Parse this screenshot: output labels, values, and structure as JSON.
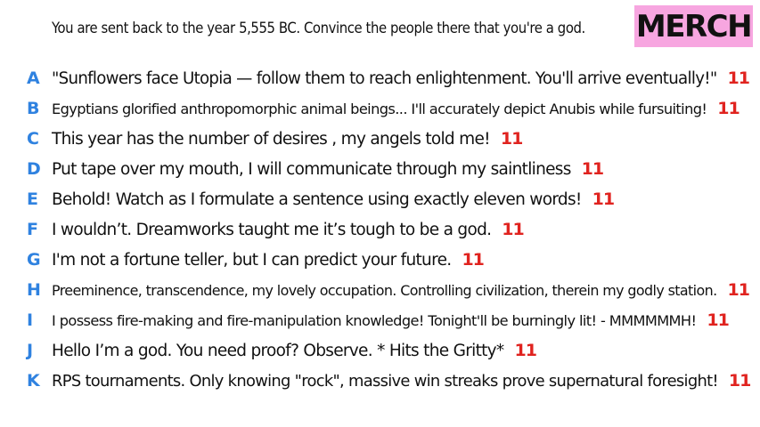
{
  "prompt": "You are sent back to the year 5,555 BC. Convince the people there that you're a god.",
  "merch_label": "MERCH",
  "colors": {
    "letter": "#2f82e0",
    "score": "#e0231f",
    "merch_bg": "#f7a6e0"
  },
  "answers": [
    {
      "letter": "A",
      "text": "\"Sunflowers face Utopia — follow them to reach enlightenment. You'll arrive eventually!\"",
      "score": "11"
    },
    {
      "letter": "B",
      "text": "Egyptians glorified anthropomorphic animal beings... I'll accurately depict Anubis while fursuiting!",
      "score": "11"
    },
    {
      "letter": "C",
      "text": "This year has the number of desires , my angels told me!",
      "score": "11"
    },
    {
      "letter": "D",
      "text": "Put tape over my mouth, I will communicate through my saintliness",
      "score": "11"
    },
    {
      "letter": "E",
      "text": "Behold! Watch as I formulate a sentence using exactly eleven words!",
      "score": "11"
    },
    {
      "letter": "F",
      "text": "I wouldn’t. Dreamworks taught me it’s tough to be a god.",
      "score": "11"
    },
    {
      "letter": "G",
      "text": "I'm not a fortune teller, but I can predict your future.",
      "score": "11"
    },
    {
      "letter": "H",
      "text": "Preeminence, transcendence, my lovely occupation. Controlling civilization, therein my godly station.",
      "score": "11"
    },
    {
      "letter": "I",
      "text": "I possess fire-making and fire-manipulation knowledge! Tonight'll be burningly lit! - MMMMMMH!",
      "score": "11"
    },
    {
      "letter": "J",
      "text": "Hello I’m a god. You need proof? Observe. * Hits the Gritty*",
      "score": "11"
    },
    {
      "letter": "K",
      "text": "RPS tournaments. Only knowing \"rock\", massive win streaks prove supernatural foresight!",
      "score": "11"
    }
  ]
}
